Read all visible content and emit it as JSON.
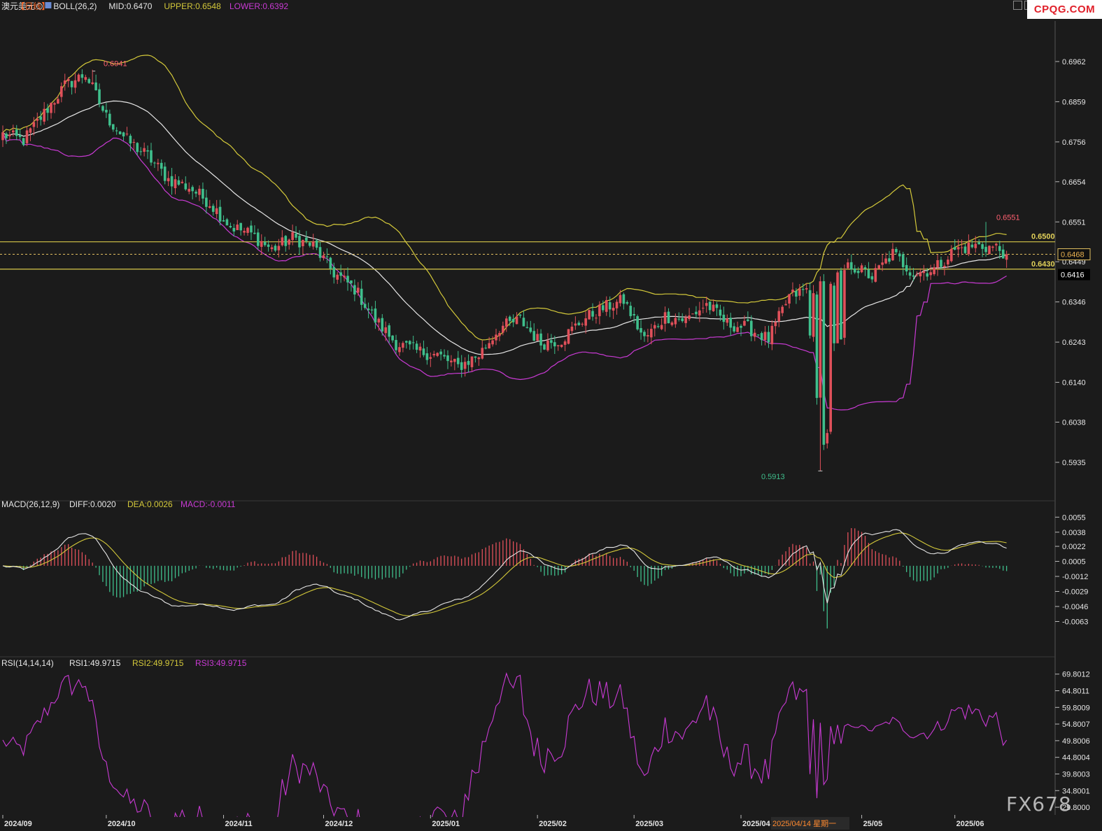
{
  "header": {
    "symbol": "澳元美元",
    "period": "【日线】",
    "settings_icon": "gear-icon",
    "boll_label": "BOLL(26,2)",
    "boll_mid": "MID:0.6470",
    "boll_upper": "UPPER:0.6548",
    "boll_lower": "LOWER:0.6392"
  },
  "macd_header": {
    "label": "MACD(26,12,9)",
    "diff": "DIFF:0.0020",
    "dea": "DEA:0.0026",
    "macd": "MACD:-0.0011"
  },
  "rsi_header": {
    "label": "RSI(14,14,14)",
    "rsi1": "RSI1:49.9715",
    "rsi2": "RSI2:49.9715",
    "rsi3": "RSI3:49.9715"
  },
  "price_levels": {
    "high": "0.6941",
    "low": "0.5913",
    "recent_high": "0.6551",
    "level_0650": "0.6500",
    "level_0643": "0.6430",
    "current_price": "0.6468",
    "lower_band_price": "0.6416"
  },
  "axis_date_hover": "2025/04/14 星期一",
  "logo": "CPQG.COM",
  "watermark": "FX678",
  "colors": {
    "up": "#e0505a",
    "down": "#3fbf8c",
    "mid": "#e6e6e6",
    "upper": "#d4c93a",
    "lower": "#c93ad4",
    "level_line": "#d8c84a",
    "background": "#1b1b1b"
  },
  "chart_data": [
    {
      "type": "candlestick",
      "title": "澳元美元 日线",
      "y_ticks": [
        "0.6962",
        "0.6859",
        "0.6756",
        "0.6654",
        "0.6551",
        "0.6449",
        "0.6346",
        "0.6243",
        "0.6140",
        "0.6038",
        "0.5935"
      ],
      "x_ticks": [
        "2024/09",
        "2024/10",
        "2024/11",
        "2024/12",
        "2025/01",
        "2025/02",
        "2025/03",
        "2025/04",
        "25/05",
        "2025/06"
      ],
      "ylim": [
        0.5865,
        0.703
      ],
      "close_anchors": [
        [
          0,
          0.6775
        ],
        [
          6,
          0.676
        ],
        [
          12,
          0.683
        ],
        [
          18,
          0.69
        ],
        [
          24,
          0.693
        ],
        [
          30,
          0.682
        ],
        [
          36,
          0.676
        ],
        [
          42,
          0.672
        ],
        [
          48,
          0.666
        ],
        [
          54,
          0.664
        ],
        [
          60,
          0.66
        ],
        [
          66,
          0.654
        ],
        [
          72,
          0.652
        ],
        [
          78,
          0.648
        ],
        [
          84,
          0.651
        ],
        [
          90,
          0.649
        ],
        [
          96,
          0.642
        ],
        [
          102,
          0.638
        ],
        [
          108,
          0.63
        ],
        [
          114,
          0.624
        ],
        [
          120,
          0.622
        ],
        [
          126,
          0.621
        ],
        [
          132,
          0.618
        ],
        [
          138,
          0.621
        ],
        [
          144,
          0.628
        ],
        [
          150,
          0.63
        ],
        [
          156,
          0.624
        ],
        [
          162,
          0.625
        ],
        [
          168,
          0.63
        ],
        [
          174,
          0.633
        ],
        [
          180,
          0.635
        ],
        [
          186,
          0.625
        ],
        [
          192,
          0.631
        ],
        [
          198,
          0.63
        ],
        [
          204,
          0.634
        ],
        [
          210,
          0.629
        ],
        [
          216,
          0.628
        ],
        [
          222,
          0.625
        ],
        [
          228,
          0.636
        ],
        [
          234,
          0.638
        ],
        [
          240,
          0.64
        ],
        [
          246,
          0.644
        ],
        [
          252,
          0.641
        ],
        [
          258,
          0.647
        ],
        [
          264,
          0.642
        ],
        [
          270,
          0.643
        ],
        [
          276,
          0.648
        ],
        [
          282,
          0.649
        ],
        [
          288,
          0.6485
        ],
        [
          291,
          0.6468
        ]
      ],
      "events": [
        {
          "index": 234,
          "close": 0.626
        },
        {
          "index": 236,
          "close": 0.61
        },
        {
          "index": 238,
          "close": 0.598
        },
        {
          "index": 239,
          "close": 0.601
        },
        {
          "index": 241,
          "close": 0.624
        },
        {
          "index": 243,
          "close": 0.625
        }
      ],
      "bollinger": {
        "mid": 0.647,
        "upper": 0.6548,
        "lower": 0.6392
      },
      "annotations": [
        "0.6941",
        "0.5913",
        "0.6551"
      ],
      "horizontal_levels": [
        0.65,
        0.643
      ],
      "current_price": 0.6468
    },
    {
      "type": "line",
      "title": "MACD(26,12,9)",
      "y_ticks": [
        "0.0055",
        "0.0038",
        "0.0022",
        "0.0005",
        "-0.0012",
        "-0.0029",
        "-0.0046",
        "-0.0063"
      ],
      "ylim": [
        -0.008,
        0.006
      ],
      "series": [
        {
          "name": "DIFF",
          "last": 0.002
        },
        {
          "name": "DEA",
          "last": 0.0026
        },
        {
          "name": "MACD",
          "last": -0.0011
        }
      ]
    },
    {
      "type": "line",
      "title": "RSI(14,14,14)",
      "y_ticks": [
        "69.8012",
        "64.8011",
        "59.8009",
        "54.8007",
        "49.8006",
        "44.8004",
        "39.8003",
        "34.8001",
        "29.8000"
      ],
      "ylim": [
        27.5,
        71.0
      ],
      "series": [
        {
          "name": "RSI1",
          "last": 49.9715
        }
      ]
    }
  ]
}
